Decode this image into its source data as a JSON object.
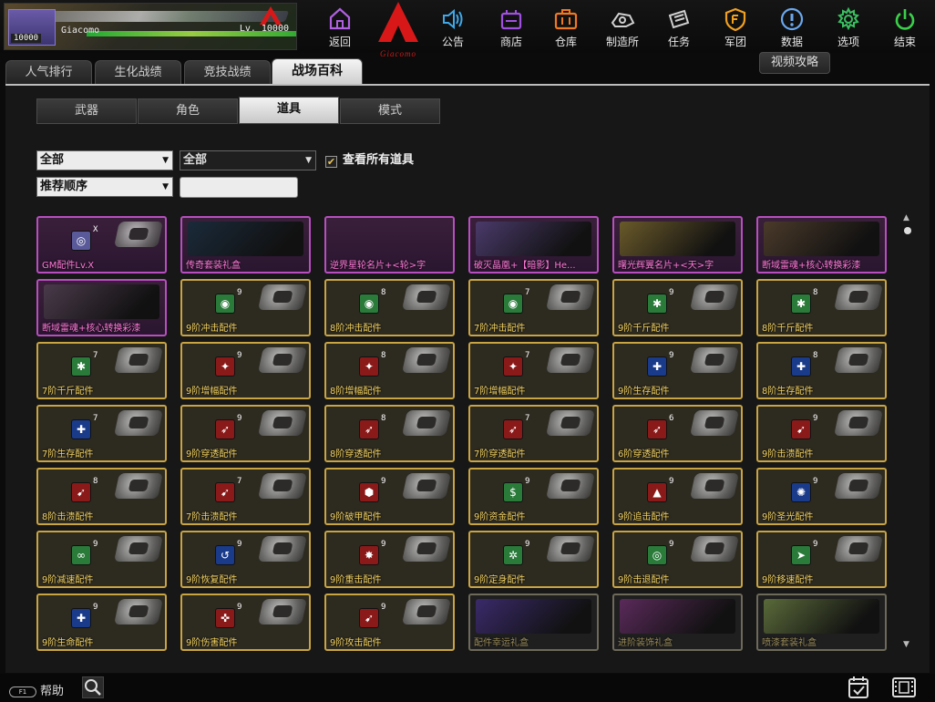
{
  "player": {
    "level_badge": "10000",
    "name": "Giacomo",
    "level_text": "Lv. 10000"
  },
  "logo_caption": "Giacomo",
  "nav": [
    {
      "id": "back",
      "label": "返回",
      "icon": "home-icon",
      "color": "#b060e0"
    },
    {
      "id": "notice",
      "label": "公告",
      "icon": "speaker-icon",
      "color": "#3fa8e8"
    },
    {
      "id": "shop",
      "label": "商店",
      "icon": "shop-icon",
      "color": "#a050e0"
    },
    {
      "id": "warehouse",
      "label": "仓库",
      "icon": "briefcase-icon",
      "color": "#f07820"
    },
    {
      "id": "craft",
      "label": "制造所",
      "icon": "craft-icon",
      "color": "#d0d0d0"
    },
    {
      "id": "mission",
      "label": "任务",
      "icon": "ticket-icon",
      "color": "#d0d0d0"
    },
    {
      "id": "legion",
      "label": "军团",
      "icon": "shield-icon",
      "color": "#f0a020"
    },
    {
      "id": "data",
      "label": "数据",
      "icon": "info-icon",
      "color": "#6aa8f0"
    },
    {
      "id": "options",
      "label": "选项",
      "icon": "gear-icon",
      "color": "#3ac060"
    },
    {
      "id": "exit",
      "label": "结束",
      "icon": "power-icon",
      "color": "#3ad04a"
    }
  ],
  "main_tabs": [
    "人气排行",
    "生化战绩",
    "竞技战绩",
    "战场百科"
  ],
  "active_main_tab": 3,
  "video_tab": "视频攻略",
  "sub_tabs": [
    "武器",
    "角色",
    "道具",
    "模式"
  ],
  "active_sub_tab": 2,
  "filters": {
    "type": "全部",
    "subtype": "全部",
    "sort": "推荐顺序",
    "search_value": "",
    "show_all_label": "查看所有道具",
    "show_all_checked": true
  },
  "items": [
    {
      "name": "GM配件Lv.X",
      "style": "purple",
      "kind": "part",
      "badge_color": "#5a5a9a",
      "tier": "X",
      "glyph": "◎"
    },
    {
      "name": "传奇套装礼盒",
      "style": "purple",
      "kind": "art",
      "art": "#1a2a3a"
    },
    {
      "name": "逆界星轮名片+<轮>字",
      "style": "purple",
      "kind": "blank"
    },
    {
      "name": "破灭晶凰+【暗影】He...",
      "style": "purple",
      "kind": "art",
      "art": "#4a3a6a"
    },
    {
      "name": "曙光辉翼名片+<天>字",
      "style": "purple",
      "kind": "art",
      "art": "#6a5a2a"
    },
    {
      "name": "断域雷魂+核心转换彩漆",
      "style": "purple",
      "kind": "art",
      "art": "#4a3a2a"
    },
    {
      "name": "断域雷魂+核心转换彩漆",
      "style": "purple",
      "kind": "art",
      "art": "#4a3a4a"
    },
    {
      "name": "9阶冲击配件",
      "kind": "part",
      "badge_color": "#2a7a3a",
      "tier": "9",
      "glyph": "◉"
    },
    {
      "name": "8阶冲击配件",
      "kind": "part",
      "badge_color": "#2a7a3a",
      "tier": "8",
      "glyph": "◉"
    },
    {
      "name": "7阶冲击配件",
      "kind": "part",
      "badge_color": "#2a7a3a",
      "tier": "7",
      "glyph": "◉"
    },
    {
      "name": "9阶千斤配件",
      "kind": "part",
      "badge_color": "#2a7a3a",
      "tier": "9",
      "glyph": "✱"
    },
    {
      "name": "8阶千斤配件",
      "kind": "part",
      "badge_color": "#2a7a3a",
      "tier": "8",
      "glyph": "✱"
    },
    {
      "name": "7阶千斤配件",
      "kind": "part",
      "badge_color": "#2a7a3a",
      "tier": "7",
      "glyph": "✱"
    },
    {
      "name": "9阶增幅配件",
      "kind": "part",
      "badge_color": "#8a1a1a",
      "tier": "9",
      "glyph": "✦"
    },
    {
      "name": "8阶增幅配件",
      "kind": "part",
      "badge_color": "#8a1a1a",
      "tier": "8",
      "glyph": "✦"
    },
    {
      "name": "7阶增幅配件",
      "kind": "part",
      "badge_color": "#8a1a1a",
      "tier": "7",
      "glyph": "✦"
    },
    {
      "name": "9阶生存配件",
      "kind": "part",
      "badge_color": "#1a3a8a",
      "tier": "9",
      "glyph": "✚"
    },
    {
      "name": "8阶生存配件",
      "kind": "part",
      "badge_color": "#1a3a8a",
      "tier": "8",
      "glyph": "✚"
    },
    {
      "name": "7阶生存配件",
      "kind": "part",
      "badge_color": "#1a3a8a",
      "tier": "7",
      "glyph": "✚"
    },
    {
      "name": "9阶穿透配件",
      "kind": "part",
      "badge_color": "#8a1a1a",
      "tier": "9",
      "glyph": "➶"
    },
    {
      "name": "8阶穿透配件",
      "kind": "part",
      "badge_color": "#8a1a1a",
      "tier": "8",
      "glyph": "➶"
    },
    {
      "name": "7阶穿透配件",
      "kind": "part",
      "badge_color": "#8a1a1a",
      "tier": "7",
      "glyph": "➶"
    },
    {
      "name": "6阶穿透配件",
      "kind": "part",
      "badge_color": "#8a1a1a",
      "tier": "6",
      "glyph": "➶"
    },
    {
      "name": "9阶击溃配件",
      "kind": "part",
      "badge_color": "#8a1a1a",
      "tier": "9",
      "glyph": "➹"
    },
    {
      "name": "8阶击溃配件",
      "kind": "part",
      "badge_color": "#8a1a1a",
      "tier": "8",
      "glyph": "➹"
    },
    {
      "name": "7阶击溃配件",
      "kind": "part",
      "badge_color": "#8a1a1a",
      "tier": "7",
      "glyph": "➹"
    },
    {
      "name": "9阶破甲配件",
      "kind": "part",
      "badge_color": "#8a1a1a",
      "tier": "9",
      "glyph": "⬢"
    },
    {
      "name": "9阶资金配件",
      "kind": "part",
      "badge_color": "#2a7a3a",
      "tier": "9",
      "glyph": "$"
    },
    {
      "name": "9阶追击配件",
      "kind": "part",
      "badge_color": "#8a1a1a",
      "tier": "9",
      "glyph": "▲"
    },
    {
      "name": "9阶圣光配件",
      "kind": "part",
      "badge_color": "#1a3a8a",
      "tier": "9",
      "glyph": "✺"
    },
    {
      "name": "9阶减速配件",
      "kind": "part",
      "badge_color": "#2a7a3a",
      "tier": "9",
      "glyph": "∞"
    },
    {
      "name": "9阶恢复配件",
      "kind": "part",
      "badge_color": "#1a3a8a",
      "tier": "9",
      "glyph": "↺"
    },
    {
      "name": "9阶重击配件",
      "kind": "part",
      "badge_color": "#8a1a1a",
      "tier": "9",
      "glyph": "✸"
    },
    {
      "name": "9阶定身配件",
      "kind": "part",
      "badge_color": "#2a7a3a",
      "tier": "9",
      "glyph": "✲"
    },
    {
      "name": "9阶击退配件",
      "kind": "part",
      "badge_color": "#2a7a3a",
      "tier": "9",
      "glyph": "◎"
    },
    {
      "name": "9阶移速配件",
      "kind": "part",
      "badge_color": "#2a7a3a",
      "tier": "9",
      "glyph": "➤"
    },
    {
      "name": "9阶生命配件",
      "kind": "part",
      "badge_color": "#1a3a8a",
      "tier": "9",
      "glyph": "✚"
    },
    {
      "name": "9阶伤害配件",
      "kind": "part",
      "badge_color": "#8a1a1a",
      "tier": "9",
      "glyph": "✜"
    },
    {
      "name": "9阶攻击配件",
      "kind": "part",
      "badge_color": "#8a1a1a",
      "tier": "9",
      "glyph": "➹"
    },
    {
      "name": "配件幸运礼盒",
      "style": "gift",
      "kind": "art",
      "art": "#3a2a6a"
    },
    {
      "name": "进阶装饰礼盒",
      "style": "gift",
      "kind": "art",
      "art": "#5a2a5a"
    },
    {
      "name": "喷漆套装礼盒",
      "style": "gift",
      "kind": "art",
      "art": "#5a6a3a"
    }
  ],
  "bottom": {
    "help_label": "帮助",
    "help_key": "F1"
  }
}
